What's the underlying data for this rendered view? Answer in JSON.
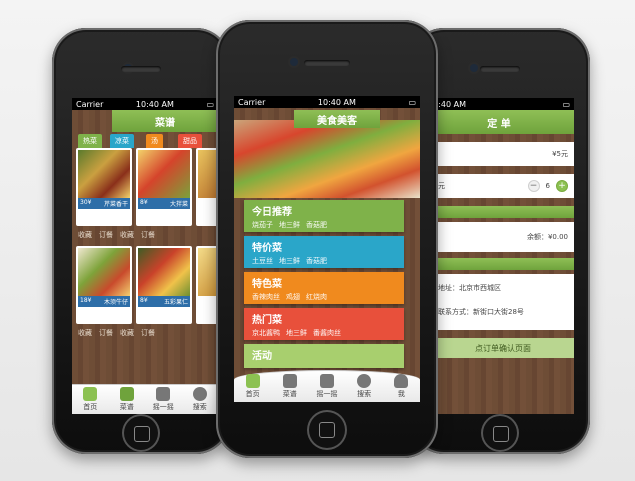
{
  "status": {
    "carrier": "Carrier",
    "time": "10:40 AM"
  },
  "left": {
    "title": "菜谱",
    "subtabs": [
      "热菜",
      "凉菜",
      "汤",
      "甜品"
    ],
    "cells": [
      {
        "price": "30¥",
        "name": "芹菜香干"
      },
      {
        "price": "8¥",
        "name": "大拌菜"
      },
      {
        "price": "18¥",
        "name": "木须牛仔"
      },
      {
        "price": "8¥",
        "name": "五彩果仁"
      }
    ],
    "row_actions": [
      "收藏",
      "订餐",
      "收藏",
      "订餐"
    ],
    "tabs": [
      "首页",
      "菜谱",
      "摇一摇",
      "搜索"
    ]
  },
  "middle": {
    "title": "美食美客",
    "categories": [
      {
        "title": "今日推荐",
        "items": [
          "烧茄子",
          "地三鲜",
          "香菇肥"
        ]
      },
      {
        "title": "特价菜",
        "items": [
          "土豆丝",
          "地三鲜",
          "香菇肥"
        ]
      },
      {
        "title": "特色菜",
        "items": [
          "香辣肉丝",
          "鸡翅",
          "红烧肉"
        ]
      },
      {
        "title": "热门菜",
        "items": [
          "京北酱鸭",
          "地三鲜",
          "番酱肉丝"
        ]
      },
      {
        "title": "活动",
        "items": []
      }
    ],
    "tabs": [
      "首页",
      "菜谱",
      "摇一摇",
      "搜索",
      "我"
    ]
  },
  "right": {
    "title": "定 单",
    "price": "¥5元",
    "qty_label": "元",
    "qty": "6",
    "balance": "余额：¥0.00",
    "addr": "地址：北京市西城区",
    "phone": "联系方式：新街口大街28号",
    "submit": "点订单确认页面"
  },
  "colors": {
    "green": "#7fb24a",
    "blue": "#2aa6c9",
    "orange": "#f08a1e",
    "red": "#e8503b",
    "wood": "#6b4a34"
  }
}
